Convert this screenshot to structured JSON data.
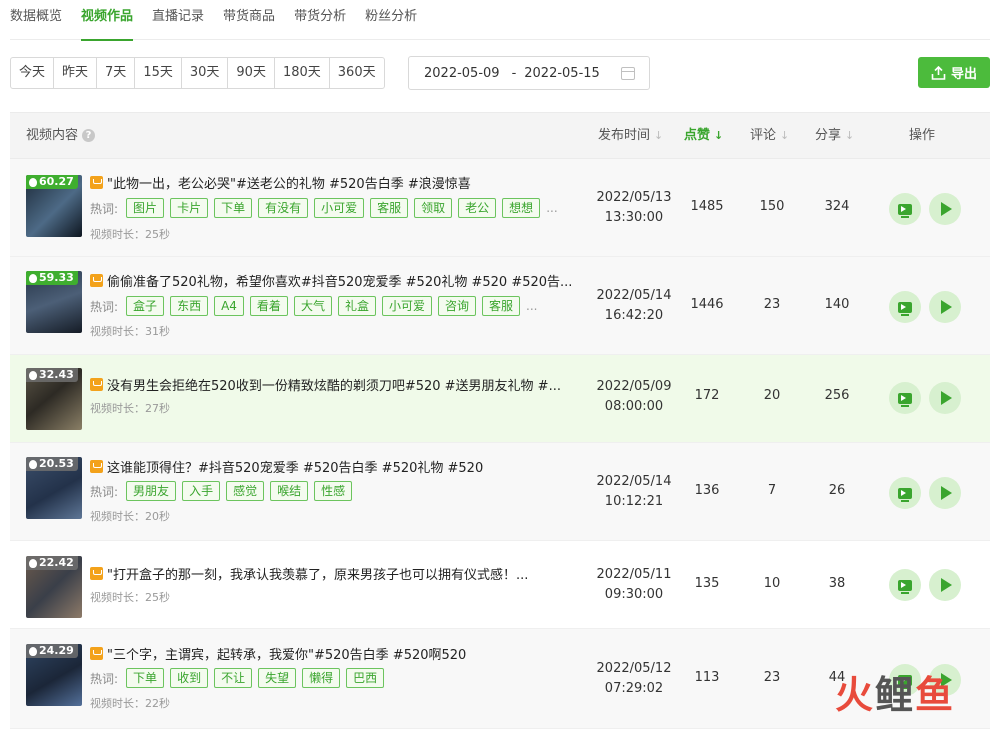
{
  "tabs": [
    "数据概览",
    "视频作品",
    "直播记录",
    "带货商品",
    "带货分析",
    "粉丝分析"
  ],
  "active_tab": 1,
  "ranges": [
    "今天",
    "昨天",
    "7天",
    "15天",
    "30天",
    "90天",
    "180天",
    "360天"
  ],
  "date_picker": {
    "start": "2022-05-09",
    "separator": "-",
    "end": "2022-05-15"
  },
  "export_label": "导出",
  "columns": {
    "content": "视频内容",
    "publish_time": "发布时间",
    "likes": "点赞",
    "comments": "评论",
    "shares": "分享",
    "actions": "操作"
  },
  "hot_label": "热词:",
  "more": "...",
  "videos": [
    {
      "score": "60.27",
      "title": "\"此物一出，老公必哭\"#送老公的礼物 #520告白季 #浪漫惊喜",
      "tags": [
        "图片",
        "卡片",
        "下单",
        "有没有",
        "小可爱",
        "客服",
        "领取",
        "老公",
        "想想"
      ],
      "duration": "视频时长：25秒",
      "date": "2022/05/13",
      "time": "13:30:00",
      "likes": "1485",
      "comments": "150",
      "shares": "324"
    },
    {
      "score": "59.33",
      "title": "偷偷准备了520礼物，希望你喜欢#抖音520宠爱季 #520礼物 #520 #520告...",
      "tags": [
        "盒子",
        "东西",
        "A4",
        "看着",
        "大气",
        "礼盒",
        "小可爱",
        "咨询",
        "客服"
      ],
      "duration": "视频时长：31秒",
      "date": "2022/05/14",
      "time": "16:42:20",
      "likes": "1446",
      "comments": "23",
      "shares": "140"
    },
    {
      "score": "32.43",
      "title": "没有男生会拒绝在520收到一份精致炫酷的剃须刀吧#520 #送男朋友礼物 #...",
      "tags": [],
      "duration": "视频时长：27秒",
      "date": "2022/05/09",
      "time": "08:00:00",
      "likes": "172",
      "comments": "20",
      "shares": "256"
    },
    {
      "score": "20.53",
      "title": "这谁能顶得住？#抖音520宠爱季 #520告白季 #520礼物 #520",
      "tags": [
        "男朋友",
        "入手",
        "感觉",
        "喉结",
        "性感"
      ],
      "duration": "视频时长：20秒",
      "date": "2022/05/14",
      "time": "10:12:21",
      "likes": "136",
      "comments": "7",
      "shares": "26"
    },
    {
      "score": "22.42",
      "title": "\"打开盒子的那一刻，我承认我羡慕了，原来男孩子也可以拥有仪式感！...",
      "tags": [],
      "duration": "视频时长：25秒",
      "date": "2022/05/11",
      "time": "09:30:00",
      "likes": "135",
      "comments": "10",
      "shares": "38"
    },
    {
      "score": "24.29",
      "title": "\"三个字，主谓宾，起转承，我爱你\"#520告白季 #520啊520",
      "tags": [
        "下单",
        "收到",
        "不让",
        "失望",
        "懒得",
        "巴西"
      ],
      "duration": "视频时长：22秒",
      "date": "2022/05/12",
      "time": "07:29:02",
      "likes": "113",
      "comments": "23",
      "shares": "44"
    }
  ],
  "watermark": {
    "a": "火",
    "b": "鲤",
    "c": "鱼"
  },
  "colors": {
    "accent": "#3aa52e",
    "button": "#4cbb3c",
    "tag_border": "#6cc45e",
    "cart": "#f3a21b",
    "highlight_row": "#f0fae9"
  }
}
